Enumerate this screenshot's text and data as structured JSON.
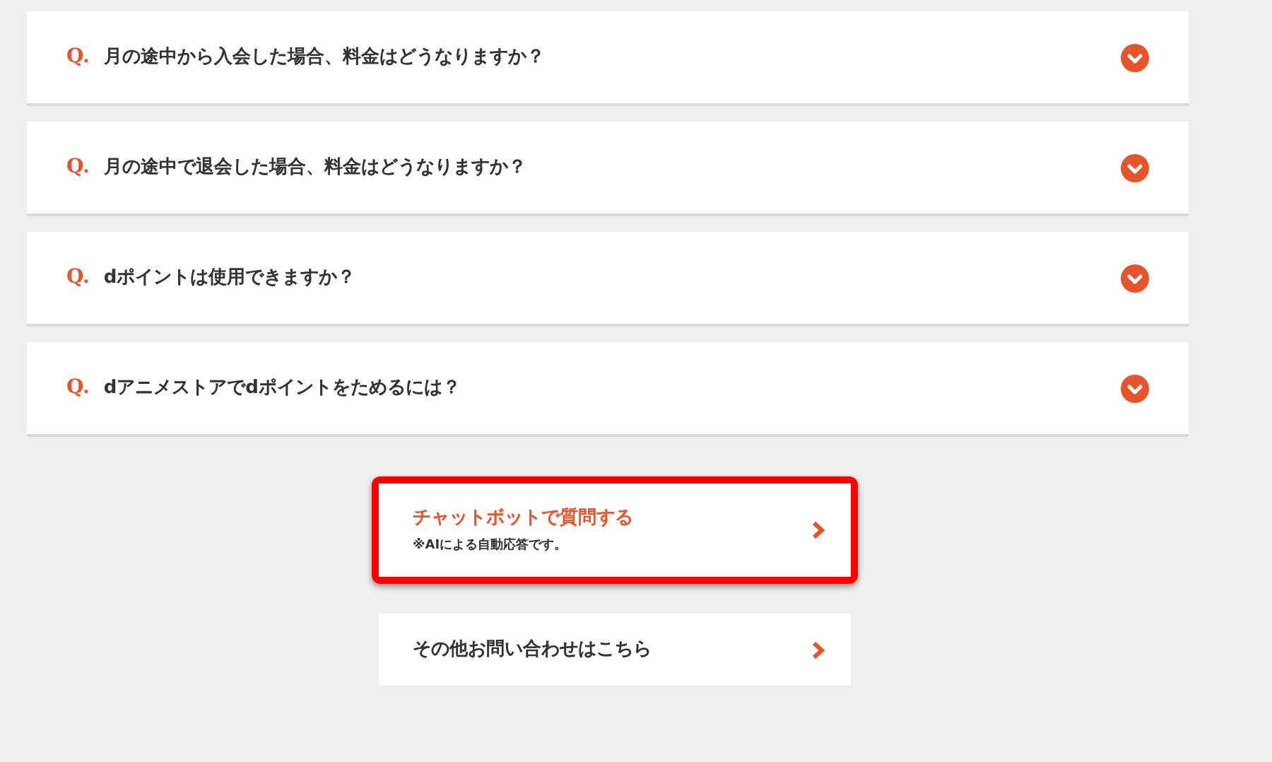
{
  "faq": [
    {
      "marker": "Q.",
      "question": "月の途中から入会した場合、料金はどうなりますか？",
      "expanded": false
    },
    {
      "marker": "Q.",
      "question": "月の途中で退会した場合、料金はどうなりますか？",
      "expanded": false
    },
    {
      "marker": "Q.",
      "question": "dポイントは使用できますか？",
      "expanded": false
    },
    {
      "marker": "Q.",
      "question": "dアニメストアでdポイントをためるには？",
      "expanded": false
    }
  ],
  "links": [
    {
      "kind": "accent",
      "title": "チャットボットで質問する",
      "note": "※AIによる自動応答です。",
      "highlighted": true
    },
    {
      "kind": "plain",
      "title": "その他お問い合わせはこちら",
      "highlighted": false
    }
  ]
}
